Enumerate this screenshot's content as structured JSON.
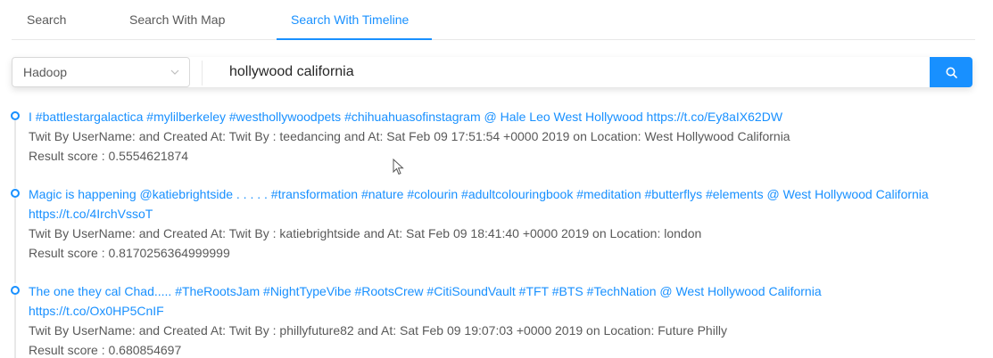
{
  "tabs": [
    {
      "label": "Search",
      "active": false
    },
    {
      "label": "Search With Map",
      "active": false
    },
    {
      "label": "Search With Timeline",
      "active": true
    }
  ],
  "search": {
    "engine_selected": "Hadoop",
    "query_value": "hollywood california",
    "button_icon": "search-icon"
  },
  "results": [
    {
      "text": "I #battlestargalactica #mylilberkeley #westhollywoodpets #chihuahuasofinstagram @ Hale Leo West Hollywood https://t.co/Ey8aIX62DW",
      "meta": "Twit By UserName: and Created At: Twit By : teedancing and At: Sat Feb 09 17:51:54 +0000 2019 on Location: West Hollywood California",
      "score": "Result score : 0.5554621874"
    },
    {
      "text": "Magic is happening @katiebrightside . . . . . #transformation #nature #colourin #adultcolouringbook #meditation #butterflys #elements @ West Hollywood California https://t.co/4IrchVssoT",
      "meta": "Twit By UserName: and Created At: Twit By : katiebrightside and At: Sat Feb 09 18:41:40 +0000 2019 on Location: london",
      "score": "Result score : 0.8170256364999999"
    },
    {
      "text": "The one they cal Chad..... #TheRootsJam #NightTypeVibe #RootsCrew #CitiSoundVault #TFT #BTS #TechNation @ West Hollywood California https://t.co/Ox0HP5CnIF",
      "meta": "Twit By UserName: and Created At: Twit By : phillyfuture82 and At: Sat Feb 09 19:07:03 +0000 2019 on Location: Future Philly",
      "score": "Result score : 0.680854697"
    }
  ],
  "colors": {
    "accent": "#1890ff",
    "text": "#595959",
    "border": "#d9d9d9"
  }
}
